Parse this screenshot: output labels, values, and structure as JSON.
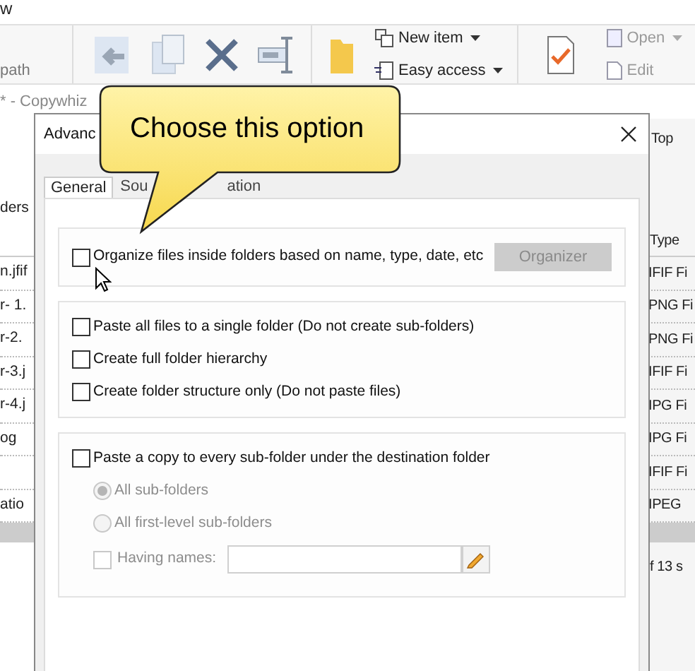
{
  "explorer": {
    "title_fragment": "w",
    "ribbon": {
      "group_label": "path",
      "new_item": "New item",
      "easy_access": "Easy access",
      "open": "Open",
      "edit": "Edit"
    },
    "app_title": "* - Copywhiz",
    "top_button": "Top",
    "left_header": "ders",
    "type_header": "Type",
    "rows": [
      {
        "name": "n.jfif",
        "type": "IFIF Fi"
      },
      {
        "name": "r- 1.",
        "type": "PNG Fi"
      },
      {
        "name": "r-2.",
        "type": "PNG Fi"
      },
      {
        "name": "r-3.j",
        "type": "IFIF Fi"
      },
      {
        "name": "r-4.j",
        "type": "IPG Fi"
      },
      {
        "name": "og",
        "type": "IPG Fi"
      },
      {
        "name": "",
        "type": "IFIF Fi"
      },
      {
        "name": "atio",
        "type": "IPEG"
      }
    ],
    "status": "f 13 s"
  },
  "dialog": {
    "title": "Advanc",
    "tabs": [
      {
        "label": "General",
        "selected": true
      },
      {
        "label": "Sou",
        "selected": false
      },
      {
        "label": "ation",
        "selected": false
      }
    ],
    "groups": [
      {
        "options": [
          {
            "kind": "checkbox",
            "label": "Organize files inside folders based on name, type, date, etc",
            "checked": false,
            "disabled": false
          }
        ],
        "button": {
          "label": "Organizer",
          "disabled": true
        }
      },
      {
        "options": [
          {
            "kind": "checkbox",
            "label": "Paste all files to a single folder (Do not create sub-folders)",
            "checked": false,
            "disabled": false
          },
          {
            "kind": "checkbox",
            "label": "Create full folder hierarchy",
            "checked": false,
            "disabled": false
          },
          {
            "kind": "checkbox",
            "label": "Create folder structure only (Do not paste files)",
            "checked": false,
            "disabled": false
          }
        ]
      },
      {
        "options": [
          {
            "kind": "checkbox",
            "label": "Paste a copy to every sub-folder under the destination folder",
            "checked": false,
            "disabled": false
          },
          {
            "kind": "radio",
            "label": "All sub-folders",
            "selected": true,
            "disabled": true
          },
          {
            "kind": "radio",
            "label": "All first-level sub-folders",
            "selected": false,
            "disabled": true
          },
          {
            "kind": "checkbox_field",
            "label": "Having names:",
            "checked": false,
            "disabled": true
          }
        ]
      }
    ]
  },
  "callout": {
    "text": "Choose this option"
  }
}
